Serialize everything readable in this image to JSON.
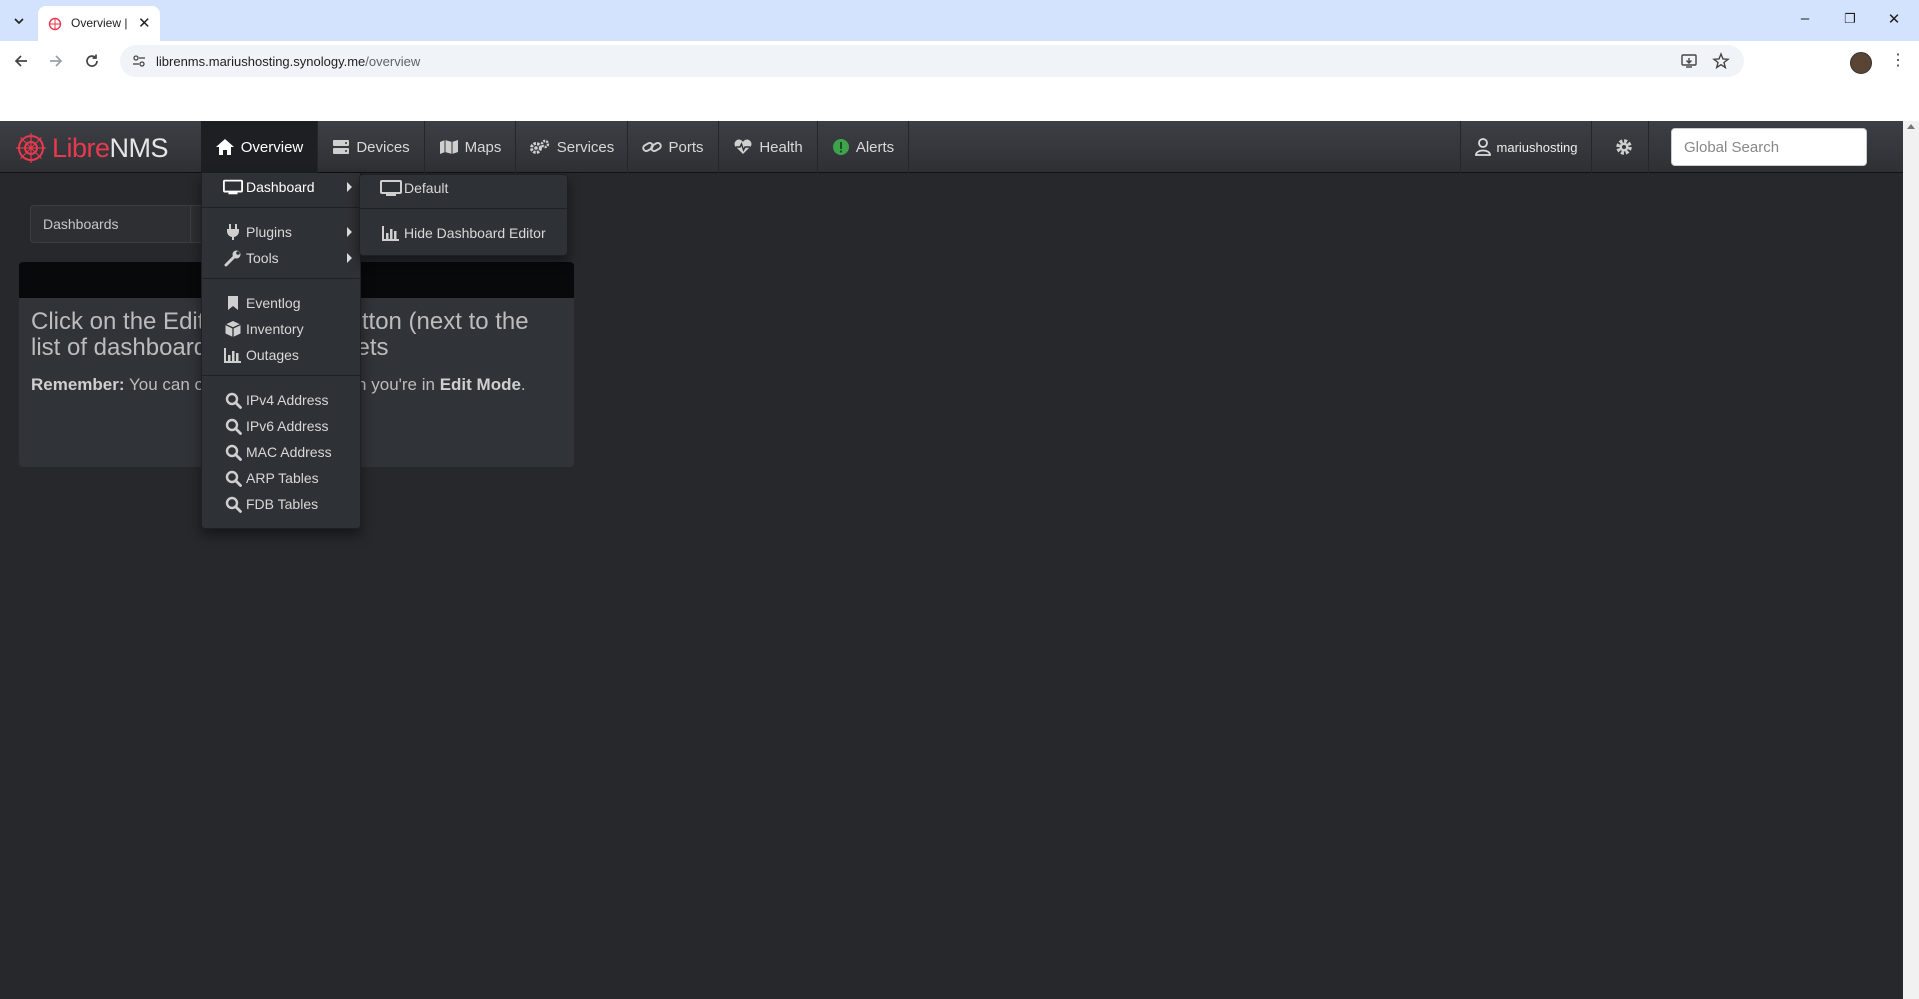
{
  "browser": {
    "tab_title": "Overview |",
    "url_host": "librenms.mariushosting.synology.me",
    "url_path": "/overview"
  },
  "navbar": {
    "brand_libre": "Libre",
    "brand_nms": "NMS",
    "items": [
      "Overview",
      "Devices",
      "Maps",
      "Services",
      "Ports",
      "Health",
      "Alerts"
    ],
    "user": "mariushosting",
    "search_placeholder": "Global Search"
  },
  "dashboard": {
    "bar_label": "Dashboards",
    "widget_heading": "Click on the Edit Dashboard button (next to the list of dashboards) to add widgets",
    "widget_note_bold": "Remember:",
    "widget_note": "You can only add widgets when you're in",
    "widget_note_mode": "Edit Mode",
    "widget_note_end": "."
  },
  "overview_menu": {
    "items": [
      "Dashboard",
      "Plugins",
      "Tools",
      "Eventlog",
      "Inventory",
      "Outages",
      "IPv4 Address",
      "IPv6 Address",
      "MAC Address",
      "ARP Tables",
      "FDB Tables"
    ]
  },
  "dashboard_submenu": {
    "items": [
      "Default",
      "Hide Dashboard Editor"
    ]
  },
  "colors": {
    "brand_red": "#e8394d",
    "alert_green": "#3fa34d",
    "page_bg": "#26282c"
  }
}
